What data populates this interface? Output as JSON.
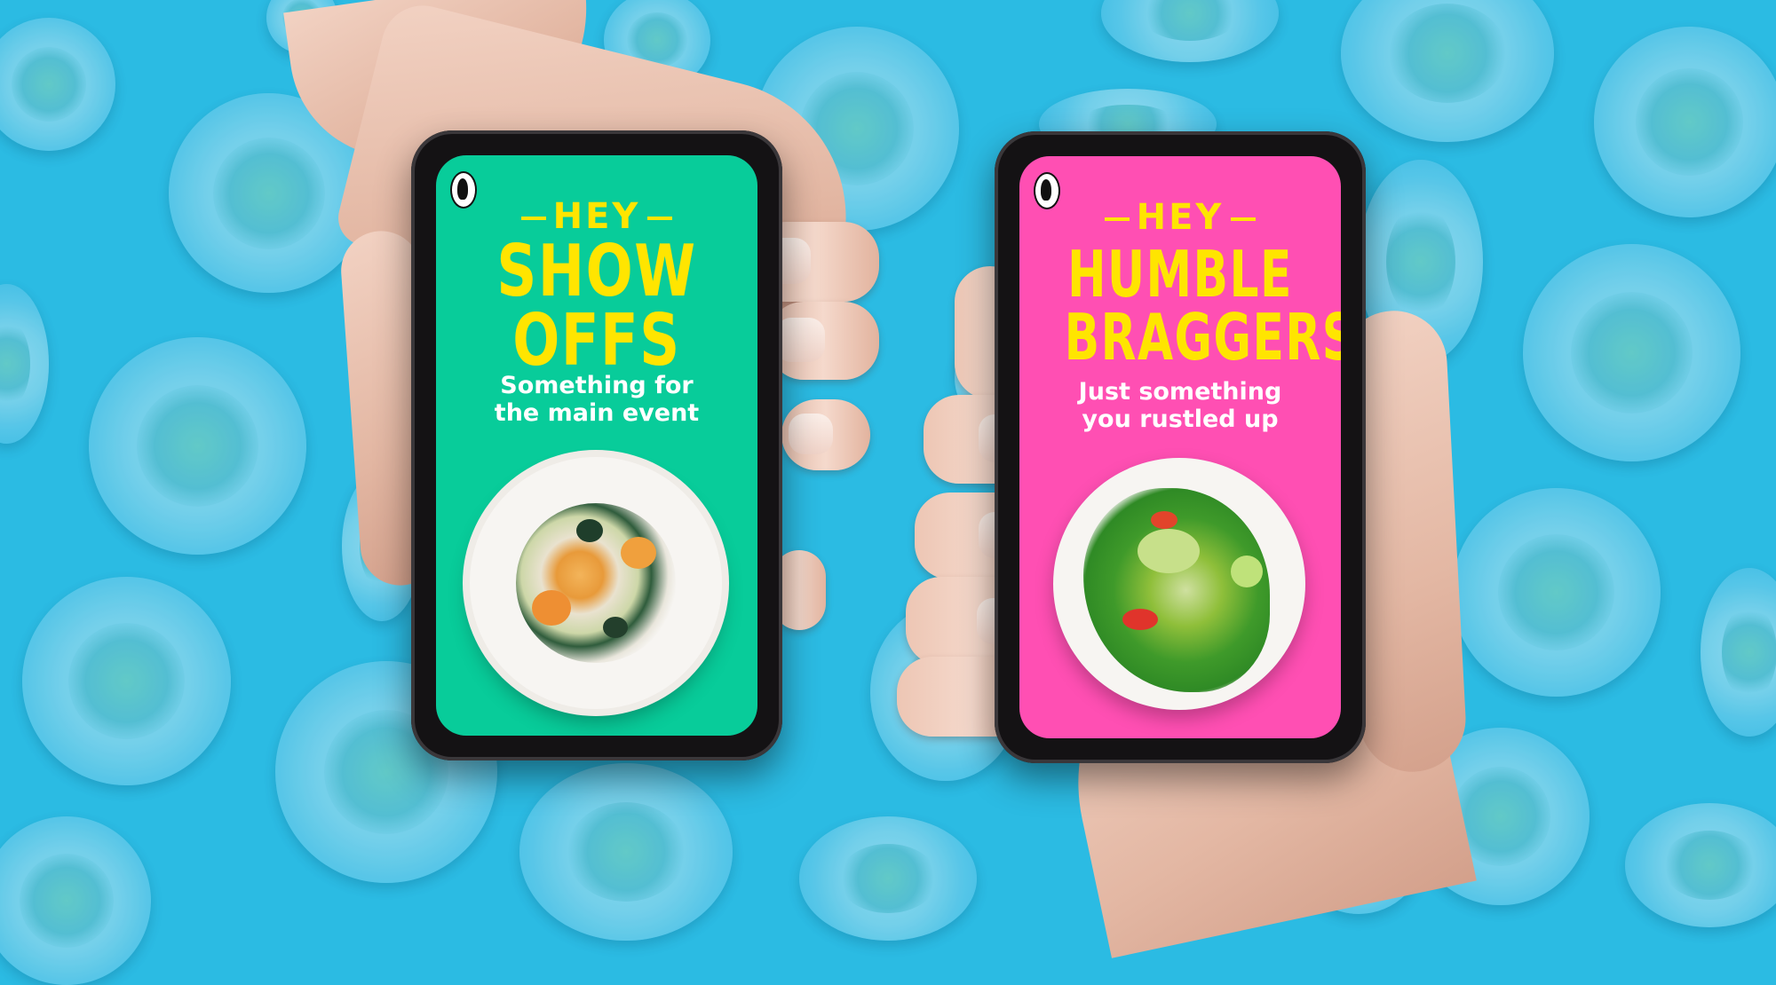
{
  "colors": {
    "background": "#2bbbe3",
    "screen_left": "#08cc9a",
    "screen_right": "#ff4fb3",
    "headline": "#ffe500",
    "subtitle": "#ffffff"
  },
  "icons": {
    "brand_logo": "penguin-logo-icon"
  },
  "phones": [
    {
      "hey": "HEY",
      "headline_lines": [
        "SHOW",
        "OFFS"
      ],
      "subtitle_lines": [
        "Something for",
        "the main event"
      ]
    },
    {
      "hey": "HEY",
      "headline_lines": [
        "HUMBLE",
        "BRAGGERS"
      ],
      "subtitle_lines": [
        "Just something",
        "you rustled up"
      ]
    }
  ]
}
